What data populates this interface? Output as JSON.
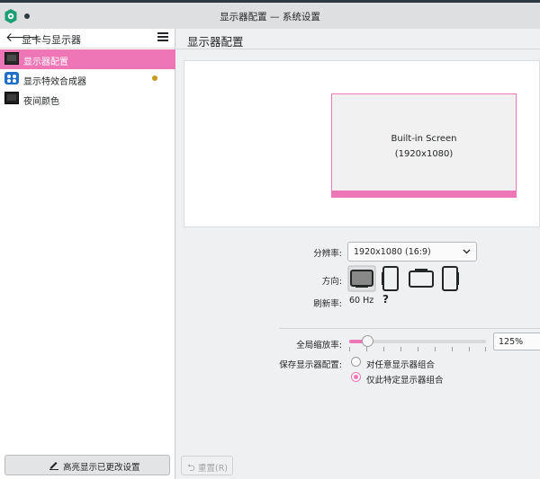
{
  "window": {
    "title": "显示器配置 — 系统设置"
  },
  "sidebar": {
    "title": "显卡与显示器",
    "items": [
      {
        "label": "显示器配置",
        "icon": "monitor-icon"
      },
      {
        "label": "显示特效合成器",
        "icon": "compositor-icon"
      },
      {
        "label": "夜间颜色",
        "icon": "night-color-icon"
      }
    ],
    "highlight_button": "高亮显示已更改设置"
  },
  "main": {
    "title": "显示器配置",
    "screen": {
      "name": "Built-in Screen",
      "resolution": "(1920x1080)"
    },
    "resolution_label": "分辨率:",
    "resolution_value": "1920x1080 (16:9)",
    "orientation_label": "方向:",
    "refresh_label": "刷新率:",
    "refresh_value": "60 Hz",
    "help_mark": "?",
    "scale_label": "全局缩放率:",
    "scale_value": "125%",
    "scale_slider_fraction": 0.125,
    "save_label": "保存显示器配置:",
    "save_options": [
      {
        "label": "对任意显示器组合",
        "checked": false
      },
      {
        "label": "仅此特定显示器组合",
        "checked": true
      }
    ],
    "reset_button": "重置(R)"
  },
  "colors": {
    "accent": "#ee76b7",
    "titlebar_border": "#2d3a44"
  }
}
